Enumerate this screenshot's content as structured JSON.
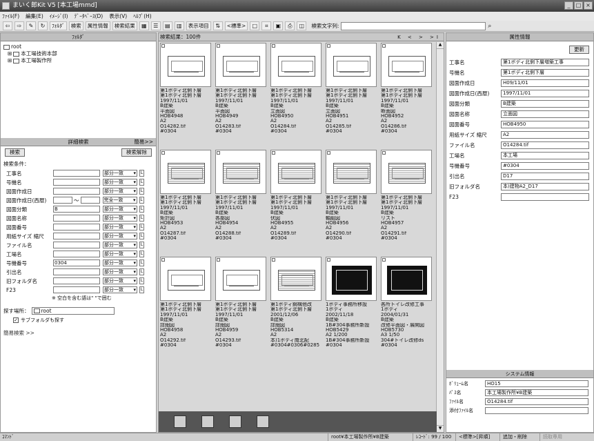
{
  "window": {
    "title": "まいく郎Kit V5 [本工場mmd]"
  },
  "menu": [
    "ﾌｧｲﾙ(F)",
    "編集(E)",
    "ｲﾒｰｼﾞ(I)",
    "ﾃﾞｰﾀﾍﾞｰｽ(D)",
    "表示(V)",
    "ﾍﾙﾌﾟ(H)"
  ],
  "toolbar": {
    "folder": "ﾌｫﾙﾀﾞ",
    "search": "検索",
    "props": "属性情報",
    "results": "検索結果",
    "display_items": "表示項目",
    "order": "<標準>",
    "search_string": "検索文字列:"
  },
  "left": {
    "header": "ﾌｫﾙﾀﾞ",
    "tree": [
      {
        "label": "root"
      },
      {
        "label": "本工場技術本部"
      },
      {
        "label": "本工場製作所"
      }
    ],
    "detail_header": "詳細検索",
    "simple_link": "簡易>>",
    "search_btn": "検索",
    "clear_btn": "検索解除",
    "cond_title": "検索条件：",
    "conditions": [
      {
        "label": "工事名",
        "value": "",
        "mode": "部分一致"
      },
      {
        "label": "号機名",
        "value": "",
        "mode": "部分一致"
      },
      {
        "label": "図面作成日",
        "value": "",
        "mode": "部分一致"
      },
      {
        "label": "図面作成日(西暦)",
        "value": "",
        "mode": "完全一致"
      },
      {
        "label": "図面分類",
        "value": "B",
        "mode": "部分一致"
      },
      {
        "label": "図面名称",
        "value": "",
        "mode": "部分一致"
      },
      {
        "label": "図面番号",
        "value": "",
        "mode": "部分一致"
      },
      {
        "label": "用紙サイズ 縮尺",
        "value": "",
        "mode": "部分一致"
      },
      {
        "label": "ファイル名",
        "value": "",
        "mode": "部分一致"
      },
      {
        "label": "工場名",
        "value": "",
        "mode": "部分一致"
      },
      {
        "label": "号機番号",
        "value": "0304",
        "mode": "部分一致"
      },
      {
        "label": "引出名",
        "value": "",
        "mode": "部分一致"
      },
      {
        "label": "旧フォルダ名",
        "value": "",
        "mode": "部分一致"
      },
      {
        "label": "F23",
        "value": "",
        "mode": "部分一致"
      }
    ],
    "note": "※ 空白を含む語は\" \"で囲む",
    "location_label": "探す場所：",
    "location_value": "root",
    "subfolder": "サブフォルダも探す",
    "simple_search": "簡易検索 >>"
  },
  "center": {
    "header": "検索結果：100件",
    "nav": "K < > >I",
    "cards": [
      {
        "l1": "第1ボディ北側下層",
        "l2": "第1ボディ北側下層",
        "l3": "1997/11/01",
        "l4": "B建築",
        "l5": "平面図",
        "l6": "HOB4948",
        "l7": "A2",
        "l8": "O14282.tif",
        "l9": "#0304"
      },
      {
        "l1": "第1ボディ北側下層",
        "l2": "第1ボディ北側下層",
        "l3": "1997/11/01",
        "l4": "B建築",
        "l5": "平面図",
        "l6": "HOB4949",
        "l7": "A2",
        "l8": "O14283.tif",
        "l9": "#0304"
      },
      {
        "l1": "第1ボディ北側下層",
        "l2": "第1ボディ北側下層",
        "l3": "1997/11/01",
        "l4": "B建築",
        "l5": "立面図",
        "l6": "HOB4950",
        "l7": "A2",
        "l8": "O14284.tif",
        "l9": "#0304"
      },
      {
        "l1": "第1ボディ北側下層",
        "l2": "第1ボディ北側下層",
        "l3": "1997/11/01",
        "l4": "B建築",
        "l5": "立面図",
        "l6": "HOB4951",
        "l7": "A2",
        "l8": "O14285.tif",
        "l9": "#0304"
      },
      {
        "l1": "第1ボディ北側下層",
        "l2": "第1ボディ北側下層",
        "l3": "1997/11/01",
        "l4": "B建築",
        "l5": "断面図",
        "l6": "HOB4952",
        "l7": "A2",
        "l8": "O14286.tif",
        "l9": "#0304"
      },
      {
        "l1": "第1ボディ北側下層",
        "l2": "第1ボディ北側下層",
        "l3": "1997/11/01",
        "l4": "B建築",
        "l5": "矩計図",
        "l6": "HOB4953",
        "l7": "A2",
        "l8": "O14287.tif",
        "l9": "#0304"
      },
      {
        "l1": "第1ボディ北側下層",
        "l2": "第1ボディ北側下層",
        "l3": "1997/11/01",
        "l4": "B建築",
        "l5": "各部図",
        "l6": "HOB4954",
        "l7": "A2",
        "l8": "O14288.tif",
        "l9": "#0304"
      },
      {
        "l1": "第1ボディ北側下層",
        "l2": "第1ボディ北側下層",
        "l3": "1997/11/01",
        "l4": "B建築",
        "l5": "伏図",
        "l6": "HOB4955",
        "l7": "A2",
        "l8": "O14289.tif",
        "l9": "#0304"
      },
      {
        "l1": "第1ボディ北側下層",
        "l2": "第1ボディ北側下層",
        "l3": "1997/11/01",
        "l4": "B建築",
        "l5": "軸組図",
        "l6": "HOB4956",
        "l7": "A2",
        "l8": "O14290.tif",
        "l9": "#0304"
      },
      {
        "l1": "第1ボディ北側下層",
        "l2": "第1ボディ北側下層",
        "l3": "1997/11/01",
        "l4": "B建築",
        "l5": "リスト",
        "l6": "HOB4957",
        "l7": "A2",
        "l8": "O14291.tif",
        "l9": "#0304"
      },
      {
        "l1": "第1ボディ北側下層",
        "l2": "第1ボディ北側下層",
        "l3": "1997/11/01",
        "l4": "B建築",
        "l5": "詳細図",
        "l6": "HOB4958",
        "l7": "A2",
        "l8": "O14292.tif",
        "l9": "#0304"
      },
      {
        "l1": "第1ボディ北側下層",
        "l2": "第1ボディ北側下層",
        "l3": "1997/11/01",
        "l4": "B建築",
        "l5": "詳細図",
        "l6": "HOB4959",
        "l7": "A2",
        "l8": "O14293.tif",
        "l9": "#0304"
      },
      {
        "l1": "第1ボディ鋼構他改",
        "l2": "第1ボディ北側下層",
        "l3": "2001/12/06",
        "l4": "B建築",
        "l5": "詳細図",
        "l6": "HOB5314",
        "l7": "A2",
        "l8": "本)1ボディ南北配",
        "l9": "#0304#0306#0285"
      },
      {
        "l1": "1ボディ事務所移設",
        "l2": "1ボディ",
        "l3": "2002/11/18",
        "l4": "B建築",
        "l5": "1B#304事務所新設",
        "l6": "HOB5429",
        "l7": "A2 1/200",
        "l8": "1B#304事務所新設",
        "l9": "#0304"
      },
      {
        "l1": "各所トイレ改修工事",
        "l2": "1ボディ",
        "l3": "2004/01/31",
        "l4": "B建築",
        "l5": "改修平面図・展開図",
        "l6": "HOB5730",
        "l7": "A3 1/50",
        "l8": "304#トイレ改修ds",
        "l9": "#0304"
      }
    ]
  },
  "right": {
    "header": "属性情報",
    "update_btn": "更新",
    "props": [
      {
        "label": "工事名",
        "value": "第1ボディ北側下層増築工事"
      },
      {
        "label": "号機名",
        "value": "第1ボディ北側下層"
      },
      {
        "label": "図面作成日",
        "value": "H09/11/01"
      },
      {
        "label": "図面作成日(西暦)",
        "value": "1997/11/01"
      },
      {
        "label": "図面分類",
        "value": "B建築"
      },
      {
        "label": "図面名称",
        "value": "立面図"
      },
      {
        "label": "図面番号",
        "value": "HOB4950"
      },
      {
        "label": "用紙サイズ 縮尺",
        "value": "A2"
      },
      {
        "label": "ファイル名",
        "value": "O14284.tif"
      },
      {
        "label": "工場名",
        "value": "本工場"
      },
      {
        "label": "号機番号",
        "value": "#0304"
      },
      {
        "label": "引出名",
        "value": "D17"
      },
      {
        "label": "旧フォルダ名",
        "value": "本)建物A2_D17"
      },
      {
        "label": "F23",
        "value": ""
      }
    ],
    "sys_header": "システム情報",
    "sys": [
      {
        "label": "ﾎﾞﾘｭｰﾑ名",
        "value": "HO15"
      },
      {
        "label": "ﾊﾟｽ名",
        "value": "本工場製作所¥B建築"
      },
      {
        "label": "ﾌｧｲﾙ名",
        "value": "O14284.tif"
      },
      {
        "label": "添付ﾌｧｲﾙ名",
        "value": ""
      }
    ]
  },
  "status": {
    "cmd": "ｺﾏﾝﾄﾞ",
    "path": "root¥本工場製作所¥B建築",
    "record": "ﾚｺｰﾄﾞ: 99 / 100",
    "mode": "<標準>[昇順]",
    "add": "追加・削除",
    "readonly": "読取専用"
  }
}
